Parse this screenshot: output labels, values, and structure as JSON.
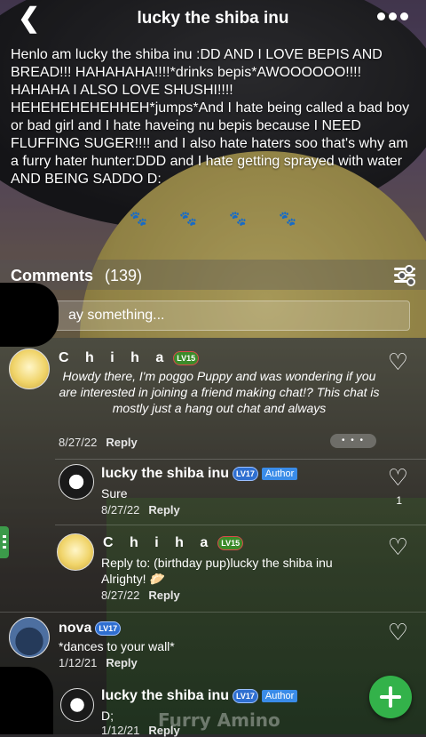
{
  "header": {
    "title": "lucky the shiba inu",
    "back_icon": "chevron-left-icon",
    "more_icon": "more-dots-icon"
  },
  "bio": {
    "text": "Henlo am lucky the shiba inu :DD AND I LOVE BEPIS AND BREAD!!! HAHAHAHA!!!!*drinks bepis*AWOOOOOO!!!! HAHAHA I ALSO LOVE SHUSHI!!!! HEHEHEHEHEHHEH*jumps*And I hate being called a bad boy or bad girl and I hate haveing nu bepis because I NEED FLUFFING SUGER!!!! and I also hate haters soo that's why am a furry hater hunter:DDD and I hate getting sprayed with water AND BEING SADDO D:",
    "paws": [
      "🐾",
      "🐾",
      "🐾",
      "🐾"
    ]
  },
  "comments_header": {
    "label": "Comments",
    "count": "(139)",
    "filter_icon": "filter-sliders-icon"
  },
  "composer": {
    "placeholder": "ay something..."
  },
  "comments": [
    {
      "user": "C h i h a",
      "level": "LV15",
      "text": "Howdy there, I'm poggo Puppy and was wondering if you are  interested in joining a friend making chat!? This chat is mostly just a hang out chat and always",
      "date": "8/27/22",
      "reply": "Reply",
      "more": "• • •"
    },
    {
      "user": "lucky the shiba inu",
      "level": "LV17",
      "badge": "Author",
      "text": "Sure",
      "date": "8/27/22",
      "reply": "Reply",
      "likes": "1"
    },
    {
      "user": "C h i h a",
      "level": "LV15",
      "reply_to": "Reply to: (birthday pup)lucky the shiba inu",
      "text": "Alrighty! 🥟",
      "date": "8/27/22",
      "reply": "Reply"
    },
    {
      "user": "nova",
      "level": "LV17",
      "text": "*dances to your wall*",
      "date": "1/12/21",
      "reply": "Reply"
    },
    {
      "user": "lucky the shiba inu",
      "level": "LV17",
      "badge": "Author",
      "text": "D;",
      "date": "1/12/21",
      "reply": "Reply"
    }
  ],
  "watermark": "Furry Amino",
  "heart_glyph": "♡",
  "back_glyph": "❮"
}
